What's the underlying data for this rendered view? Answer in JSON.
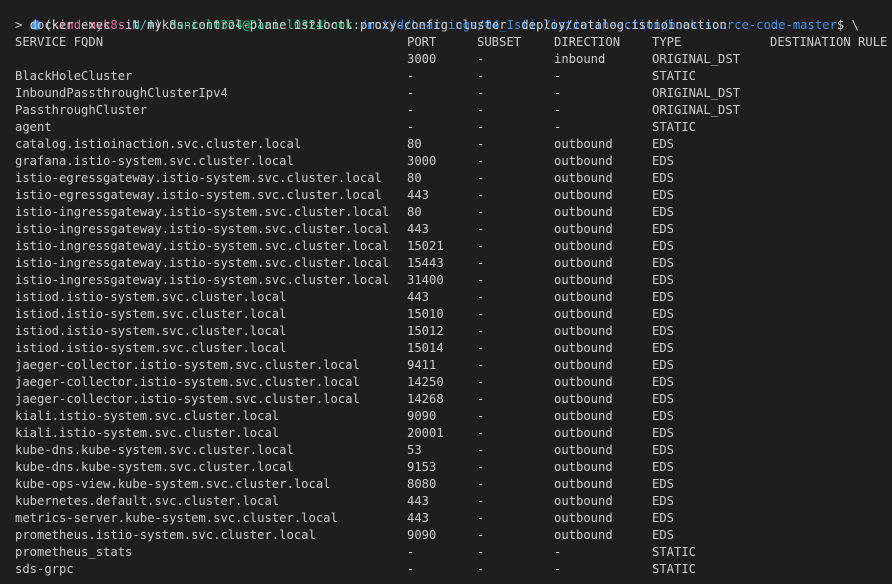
{
  "colors": {
    "background": "#1e1e1e",
    "text": "#cccccc",
    "status_dot": "#3b8eea",
    "context": "#e06c9f",
    "namespace": "#56b6c2",
    "user": "#23d18b",
    "path": "#3b8eea"
  },
  "prompt": {
    "status_icon": "circle-icon",
    "open_paren": "(",
    "context": "kind-myk8s",
    "separator": ":",
    "namespace": "N/A",
    "close_paren": ")",
    "user_host": "daniel0324@Daniel0324book",
    "path_sep": ":",
    "path": "/mnt/d/Learnings/04_Istio/istio-in-action/book-source-code-master",
    "suffix": "$ \\"
  },
  "command": "> docker exec -it myk8s-control-plane istioctl proxy-config cluster  deploy/catalog.istioinaction",
  "table": {
    "headers": {
      "fqdn": "SERVICE FQDN",
      "port": "PORT",
      "subset": "SUBSET",
      "direction": "DIRECTION",
      "type": "TYPE",
      "rule": "DESTINATION RULE"
    },
    "rows": [
      {
        "fqdn": "",
        "port": "3000",
        "subset": "-",
        "direction": "inbound",
        "type": "ORIGINAL_DST",
        "rule": ""
      },
      {
        "fqdn": "BlackHoleCluster",
        "port": "-",
        "subset": "-",
        "direction": "-",
        "type": "STATIC",
        "rule": ""
      },
      {
        "fqdn": "InboundPassthroughClusterIpv4",
        "port": "-",
        "subset": "-",
        "direction": "-",
        "type": "ORIGINAL_DST",
        "rule": ""
      },
      {
        "fqdn": "PassthroughCluster",
        "port": "-",
        "subset": "-",
        "direction": "-",
        "type": "ORIGINAL_DST",
        "rule": ""
      },
      {
        "fqdn": "agent",
        "port": "-",
        "subset": "-",
        "direction": "-",
        "type": "STATIC",
        "rule": ""
      },
      {
        "fqdn": "catalog.istioinaction.svc.cluster.local",
        "port": "80",
        "subset": "-",
        "direction": "outbound",
        "type": "EDS",
        "rule": ""
      },
      {
        "fqdn": "grafana.istio-system.svc.cluster.local",
        "port": "3000",
        "subset": "-",
        "direction": "outbound",
        "type": "EDS",
        "rule": ""
      },
      {
        "fqdn": "istio-egressgateway.istio-system.svc.cluster.local",
        "port": "80",
        "subset": "-",
        "direction": "outbound",
        "type": "EDS",
        "rule": ""
      },
      {
        "fqdn": "istio-egressgateway.istio-system.svc.cluster.local",
        "port": "443",
        "subset": "-",
        "direction": "outbound",
        "type": "EDS",
        "rule": ""
      },
      {
        "fqdn": "istio-ingressgateway.istio-system.svc.cluster.local",
        "port": "80",
        "subset": "-",
        "direction": "outbound",
        "type": "EDS",
        "rule": ""
      },
      {
        "fqdn": "istio-ingressgateway.istio-system.svc.cluster.local",
        "port": "443",
        "subset": "-",
        "direction": "outbound",
        "type": "EDS",
        "rule": ""
      },
      {
        "fqdn": "istio-ingressgateway.istio-system.svc.cluster.local",
        "port": "15021",
        "subset": "-",
        "direction": "outbound",
        "type": "EDS",
        "rule": ""
      },
      {
        "fqdn": "istio-ingressgateway.istio-system.svc.cluster.local",
        "port": "15443",
        "subset": "-",
        "direction": "outbound",
        "type": "EDS",
        "rule": ""
      },
      {
        "fqdn": "istio-ingressgateway.istio-system.svc.cluster.local",
        "port": "31400",
        "subset": "-",
        "direction": "outbound",
        "type": "EDS",
        "rule": ""
      },
      {
        "fqdn": "istiod.istio-system.svc.cluster.local",
        "port": "443",
        "subset": "-",
        "direction": "outbound",
        "type": "EDS",
        "rule": ""
      },
      {
        "fqdn": "istiod.istio-system.svc.cluster.local",
        "port": "15010",
        "subset": "-",
        "direction": "outbound",
        "type": "EDS",
        "rule": ""
      },
      {
        "fqdn": "istiod.istio-system.svc.cluster.local",
        "port": "15012",
        "subset": "-",
        "direction": "outbound",
        "type": "EDS",
        "rule": ""
      },
      {
        "fqdn": "istiod.istio-system.svc.cluster.local",
        "port": "15014",
        "subset": "-",
        "direction": "outbound",
        "type": "EDS",
        "rule": ""
      },
      {
        "fqdn": "jaeger-collector.istio-system.svc.cluster.local",
        "port": "9411",
        "subset": "-",
        "direction": "outbound",
        "type": "EDS",
        "rule": ""
      },
      {
        "fqdn": "jaeger-collector.istio-system.svc.cluster.local",
        "port": "14250",
        "subset": "-",
        "direction": "outbound",
        "type": "EDS",
        "rule": ""
      },
      {
        "fqdn": "jaeger-collector.istio-system.svc.cluster.local",
        "port": "14268",
        "subset": "-",
        "direction": "outbound",
        "type": "EDS",
        "rule": ""
      },
      {
        "fqdn": "kiali.istio-system.svc.cluster.local",
        "port": "9090",
        "subset": "-",
        "direction": "outbound",
        "type": "EDS",
        "rule": ""
      },
      {
        "fqdn": "kiali.istio-system.svc.cluster.local",
        "port": "20001",
        "subset": "-",
        "direction": "outbound",
        "type": "EDS",
        "rule": ""
      },
      {
        "fqdn": "kube-dns.kube-system.svc.cluster.local",
        "port": "53",
        "subset": "-",
        "direction": "outbound",
        "type": "EDS",
        "rule": ""
      },
      {
        "fqdn": "kube-dns.kube-system.svc.cluster.local",
        "port": "9153",
        "subset": "-",
        "direction": "outbound",
        "type": "EDS",
        "rule": ""
      },
      {
        "fqdn": "kube-ops-view.kube-system.svc.cluster.local",
        "port": "8080",
        "subset": "-",
        "direction": "outbound",
        "type": "EDS",
        "rule": ""
      },
      {
        "fqdn": "kubernetes.default.svc.cluster.local",
        "port": "443",
        "subset": "-",
        "direction": "outbound",
        "type": "EDS",
        "rule": ""
      },
      {
        "fqdn": "metrics-server.kube-system.svc.cluster.local",
        "port": "443",
        "subset": "-",
        "direction": "outbound",
        "type": "EDS",
        "rule": ""
      },
      {
        "fqdn": "prometheus.istio-system.svc.cluster.local",
        "port": "9090",
        "subset": "-",
        "direction": "outbound",
        "type": "EDS",
        "rule": ""
      },
      {
        "fqdn": "prometheus_stats",
        "port": "-",
        "subset": "-",
        "direction": "-",
        "type": "STATIC",
        "rule": ""
      },
      {
        "fqdn": "sds-grpc",
        "port": "-",
        "subset": "-",
        "direction": "-",
        "type": "STATIC",
        "rule": ""
      }
    ]
  }
}
